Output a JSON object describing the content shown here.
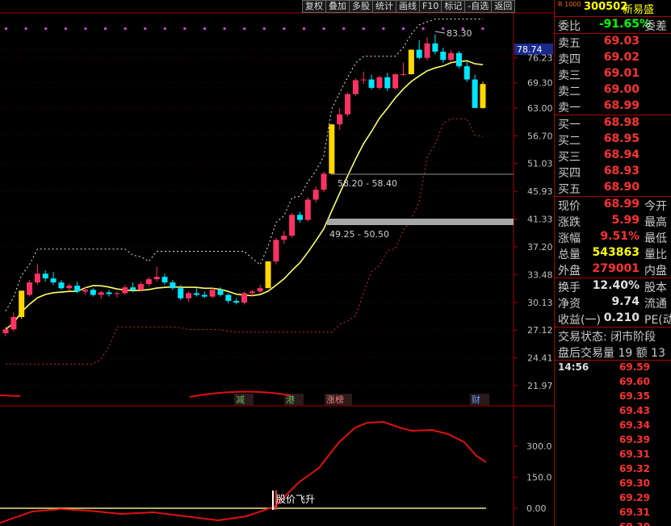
{
  "toolbar": [
    "复权",
    "叠加",
    "多股",
    "统计",
    "画线",
    "F10",
    "标记",
    "-自选",
    "返回"
  ],
  "price_axis": [
    "78.74",
    "76.23",
    "69.30",
    "63.00",
    "56.70",
    "51.03",
    "45.93",
    "41.33",
    "37.20",
    "33.48",
    "30.13",
    "27.12",
    "24.41",
    "21.97"
  ],
  "indicator_axis": [
    "300.0",
    "150.0",
    "0.00"
  ],
  "chart_labels": {
    "peak": "83.30",
    "range1": "58.20 - 58.40",
    "range2": "49.25 - 50.50",
    "signal": "股价飞升"
  },
  "event_marks": [
    "减",
    "港",
    "涨榜",
    "财"
  ],
  "quote": {
    "tag": "R 1000",
    "code": "300502",
    "name": "新易盛",
    "ratio_label": "委比",
    "ratio_value": "-91.65%",
    "ratio_ext": "委差",
    "asks": [
      {
        "label": "卖五",
        "price": "69.03"
      },
      {
        "label": "卖四",
        "price": "69.02"
      },
      {
        "label": "卖三",
        "price": "69.01"
      },
      {
        "label": "卖二",
        "price": "69.00"
      },
      {
        "label": "卖一",
        "price": "68.99"
      }
    ],
    "bids": [
      {
        "label": "买一",
        "price": "68.98"
      },
      {
        "label": "买二",
        "price": "68.95"
      },
      {
        "label": "买三",
        "price": "68.94"
      },
      {
        "label": "买四",
        "price": "68.93"
      },
      {
        "label": "买五",
        "price": "68.90"
      }
    ],
    "stats": [
      {
        "label": "现价",
        "value": "68.99",
        "ext": "今开"
      },
      {
        "label": "涨跌",
        "value": "5.99",
        "ext": "最高"
      },
      {
        "label": "涨幅",
        "value": "9.51%",
        "ext": "最低"
      },
      {
        "label": "总量",
        "value": "543863",
        "ext": "量比"
      },
      {
        "label": "外盘",
        "value": "279001",
        "ext": "内盘"
      }
    ],
    "stats2": [
      {
        "label": "换手",
        "value": "12.40%",
        "ext": "股本"
      },
      {
        "label": "净资",
        "value": "9.74",
        "ext": "流通"
      },
      {
        "label": "收益(一)",
        "value": "0.210",
        "ext": "PE(动"
      }
    ],
    "trade_status": "交易状态: 闭市阶段",
    "after_hours": "盘后交易量 19 额 13",
    "ticks": [
      {
        "time": "14:56",
        "price": "69.59"
      },
      {
        "time": "",
        "price": "69.60"
      },
      {
        "time": "",
        "price": "69.35"
      },
      {
        "time": "",
        "price": "69.43"
      },
      {
        "time": "",
        "price": "69.34"
      },
      {
        "time": "",
        "price": "69.39"
      },
      {
        "time": "",
        "price": "69.31"
      },
      {
        "time": "",
        "price": "69.32"
      },
      {
        "time": "",
        "price": "69.30"
      },
      {
        "time": "",
        "price": "69.29"
      },
      {
        "time": "",
        "price": "69.31"
      },
      {
        "time": "",
        "price": "69.30"
      }
    ]
  },
  "colors": {
    "up": "#ff3264",
    "down": "#00e5ff",
    "limit": "#ffd800",
    "ma": "#ffff66",
    "indicator": "#e01010",
    "border": "#aa0000"
  },
  "chart_data": {
    "type": "candlestick",
    "candles": [
      [
        26.8,
        27.5,
        26.5,
        27.2
      ],
      [
        27.2,
        29.0,
        27.0,
        28.5
      ],
      [
        28.5,
        31.5,
        28.3,
        31.5
      ],
      [
        31.0,
        32.8,
        30.8,
        32.5
      ],
      [
        32.5,
        34.8,
        32.2,
        33.6
      ],
      [
        33.6,
        34.0,
        32.6,
        33.0
      ],
      [
        33.0,
        33.8,
        32.2,
        32.5
      ],
      [
        32.5,
        32.8,
        31.6,
        31.8
      ],
      [
        31.8,
        32.4,
        31.5,
        32.1
      ],
      [
        32.1,
        32.6,
        31.2,
        31.4
      ],
      [
        31.4,
        31.9,
        31.0,
        31.6
      ],
      [
        31.6,
        31.8,
        30.8,
        31.0
      ],
      [
        31.0,
        31.5,
        30.5,
        31.3
      ],
      [
        31.3,
        31.6,
        30.8,
        31.1
      ],
      [
        31.1,
        31.4,
        30.7,
        31.2
      ],
      [
        31.2,
        32.2,
        31.0,
        31.9
      ],
      [
        31.9,
        32.5,
        31.3,
        31.6
      ],
      [
        31.6,
        32.6,
        31.4,
        32.3
      ],
      [
        32.3,
        33.2,
        32.0,
        32.9
      ],
      [
        32.9,
        34.5,
        32.6,
        33.2
      ],
      [
        33.2,
        33.6,
        32.2,
        32.5
      ],
      [
        32.5,
        32.8,
        31.6,
        31.8
      ],
      [
        31.8,
        32.2,
        30.4,
        30.6
      ],
      [
        30.6,
        31.4,
        30.2,
        31.2
      ],
      [
        31.2,
        31.8,
        30.8,
        31.0
      ],
      [
        31.0,
        31.4,
        30.6,
        30.8
      ],
      [
        30.8,
        31.9,
        30.6,
        31.6
      ],
      [
        31.6,
        31.9,
        30.8,
        31.0
      ],
      [
        31.0,
        31.2,
        30.0,
        30.3
      ],
      [
        30.3,
        30.6,
        29.9,
        30.1
      ],
      [
        30.1,
        31.4,
        29.9,
        31.2
      ],
      [
        31.2,
        31.6,
        30.8,
        31.4
      ],
      [
        31.4,
        32.2,
        31.2,
        31.8
      ],
      [
        31.8,
        35.2,
        31.8,
        35.2
      ],
      [
        35.2,
        38.5,
        34.8,
        38.2
      ],
      [
        38.2,
        39.5,
        37.6,
        38.8
      ],
      [
        38.8,
        42.3,
        38.5,
        42.0
      ],
      [
        42.0,
        42.5,
        40.8,
        41.2
      ],
      [
        41.2,
        44.9,
        41.0,
        44.5
      ],
      [
        44.5,
        46.8,
        44.0,
        46.2
      ],
      [
        46.2,
        49.5,
        45.8,
        49.1
      ],
      [
        49.1,
        59.2,
        49.1,
        59.2
      ],
      [
        59.2,
        63.0,
        58.0,
        61.5
      ],
      [
        61.5,
        66.8,
        61.0,
        66.4
      ],
      [
        66.4,
        70.5,
        66.0,
        70.0
      ],
      [
        70.0,
        72.3,
        69.0,
        70.2
      ],
      [
        70.2,
        71.5,
        67.6,
        68.0
      ],
      [
        68.0,
        71.2,
        67.5,
        70.8
      ],
      [
        70.8,
        72.0,
        67.2,
        67.9
      ],
      [
        67.9,
        71.8,
        67.6,
        71.6
      ],
      [
        71.6,
        74.8,
        71.2,
        71.6
      ],
      [
        71.6,
        78.6,
        71.6,
        78.6
      ],
      [
        78.6,
        81.5,
        75.8,
        76.2
      ],
      [
        76.2,
        82.4,
        75.5,
        80.5
      ],
      [
        80.5,
        83.3,
        77.2,
        78.0
      ],
      [
        78.0,
        79.2,
        74.8,
        75.6
      ],
      [
        75.6,
        78.4,
        75.2,
        77.6
      ],
      [
        77.6,
        78.2,
        73.2,
        73.8
      ],
      [
        73.8,
        75.2,
        69.6,
        70.2
      ],
      [
        70.2,
        71.5,
        63.2,
        63.0
      ],
      [
        63.0,
        69.6,
        62.8,
        68.99
      ]
    ],
    "ylim": [
      21.97,
      78.74
    ]
  }
}
